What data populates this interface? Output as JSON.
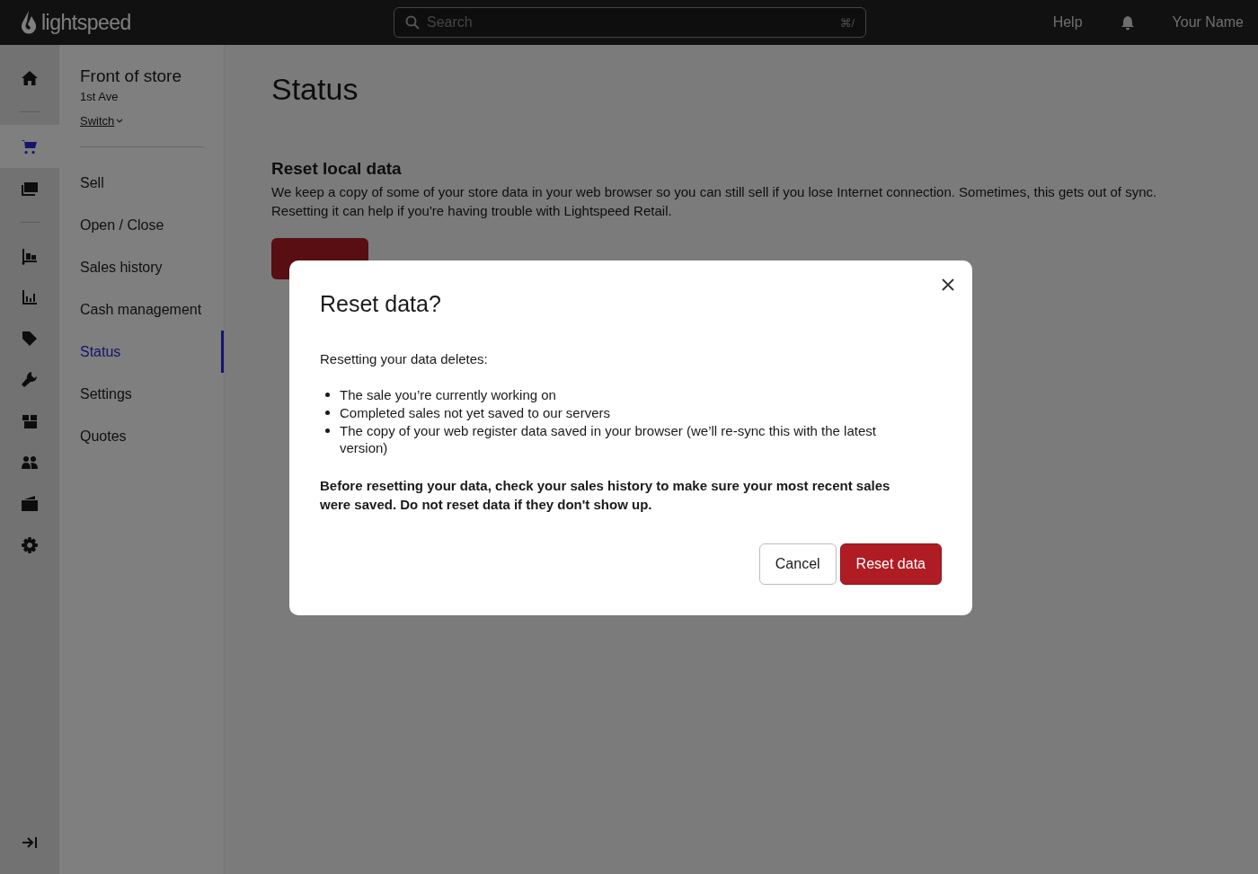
{
  "topbar": {
    "logo": "lightspeed",
    "search": {
      "placeholder": "Search",
      "shortcut": "⌘/"
    },
    "help": "Help",
    "user": "Your Name"
  },
  "rail": [
    {
      "selected": false
    },
    {
      "selected": true
    },
    {
      "selected": false
    },
    {
      "selected": false
    },
    {
      "selected": false
    },
    {
      "selected": false
    },
    {
      "selected": false
    },
    {
      "selected": false
    },
    {
      "selected": false
    },
    {
      "selected": false
    },
    {
      "selected": false
    }
  ],
  "store": {
    "name": "Front of store",
    "location": "1st Ave",
    "switch": "Switch"
  },
  "subnav": [
    {
      "label": "Sell",
      "selected": false
    },
    {
      "label": "Open / Close",
      "selected": false
    },
    {
      "label": "Sales history",
      "selected": false
    },
    {
      "label": "Cash management",
      "selected": false
    },
    {
      "label": "Status",
      "selected": true
    },
    {
      "label": "Settings",
      "selected": false
    },
    {
      "label": "Quotes",
      "selected": false
    }
  ],
  "page": {
    "title": "Status",
    "section_title": "Reset local data",
    "description": "We keep a copy of some of your store data in your web browser so you can still sell if you lose Internet connection. Sometimes, this gets out of sync. Resetting it can help if you're having trouble with Lightspeed Retail."
  },
  "modal": {
    "title": "Reset data?",
    "intro": "Resetting your data deletes:",
    "items": [
      "The sale you’re currently working on",
      "Completed sales not yet saved to our servers",
      "The copy of your web register data saved in your browser (we’ll re-sync this with the latest version)"
    ],
    "warning": "Before resetting your data, check your sales history to make sure your most recent sales were saved. Do not reset data if they don't show up.",
    "cancel": "Cancel",
    "confirm": "Reset data"
  }
}
